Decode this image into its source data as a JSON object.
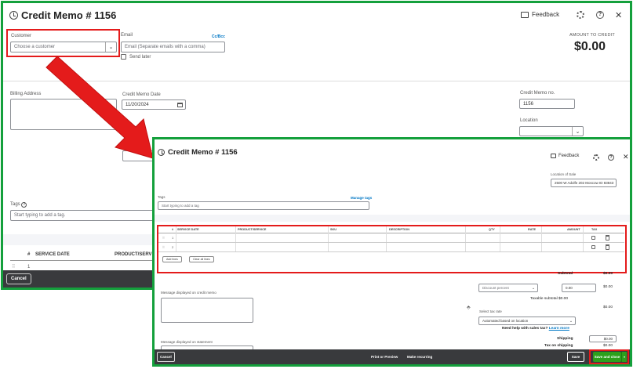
{
  "bg": {
    "title": "Credit Memo # 1156",
    "feedback": "Feedback",
    "customer_label": "Customer",
    "customer_placeholder": "Choose a customer",
    "email_label": "Email",
    "cc_bcc": "Cc/Bcc",
    "email_placeholder": "Email (Separate emails with a comma)",
    "send_later": "Send later",
    "amount_label": "AMOUNT TO CREDIT",
    "amount_value": "$0.00",
    "billing_address_label": "Billing Address",
    "date_label": "Credit Memo Date",
    "date_value": "11/20/2024",
    "memo_no_label": "Credit Memo no.",
    "memo_no_value": "1156",
    "location_label": "Location",
    "tags_label": "Tags",
    "tags_placeholder": "Start typing to add a tag.",
    "col_num": "#",
    "col_service_date": "SERVICE DATE",
    "col_product": "PRODUCT/SERVICE",
    "row_num": "1",
    "cancel": "Cancel"
  },
  "fg": {
    "title": "Credit Memo # 1156",
    "feedback": "Feedback",
    "location_of_sale_label": "Location of Sale",
    "location_of_sale_value": "2500 W Adolfe 202 Moscow ID 83843",
    "tags_label": "Tags",
    "manage_tags": "Manage tags",
    "tags_placeholder": "Start typing to add a tag",
    "columns": [
      "#",
      "SERVICE DATE",
      "PRODUCT/SERVICE",
      "SKU",
      "DESCRIPTION",
      "QTY",
      "RATE",
      "AMOUNT",
      "TAX"
    ],
    "rows": [
      "1",
      "2"
    ],
    "add_lines": "Add lines",
    "clear_all_lines": "Clear all lines",
    "subtotal_label": "Subtotal",
    "subtotal_value": "$0.00",
    "discount_select": "Discount percent",
    "discount_input": "0.00",
    "discount_value": "$0.00",
    "taxable_subtotal": "Taxable subtotal $0.00",
    "message_label": "Message displayed on credit memo",
    "select_tax_rate": "Select tax rate",
    "tax_rate_value": "Automated based on location",
    "tax_help": "Need help with sales tax?",
    "learn_more": "Learn more",
    "tax_value": "$0.00",
    "statement_label": "Message displayed on statement",
    "shipping_label": "Shipping",
    "shipping_input": "$0.00",
    "tax_on_shipping_label": "Tax on shipping",
    "tax_on_shipping_value": "$0.00",
    "cancel": "Cancel",
    "print_preview": "Print or Preview",
    "make_recurring": "Make recurring",
    "save": "Save",
    "save_and_close": "Save and close"
  },
  "colors": {
    "annotation_green": "#14a03c",
    "annotation_red": "#e41b1b",
    "footer_dark": "#393a3d",
    "primary_green": "#2ca01c",
    "link_blue": "#0077c5"
  }
}
